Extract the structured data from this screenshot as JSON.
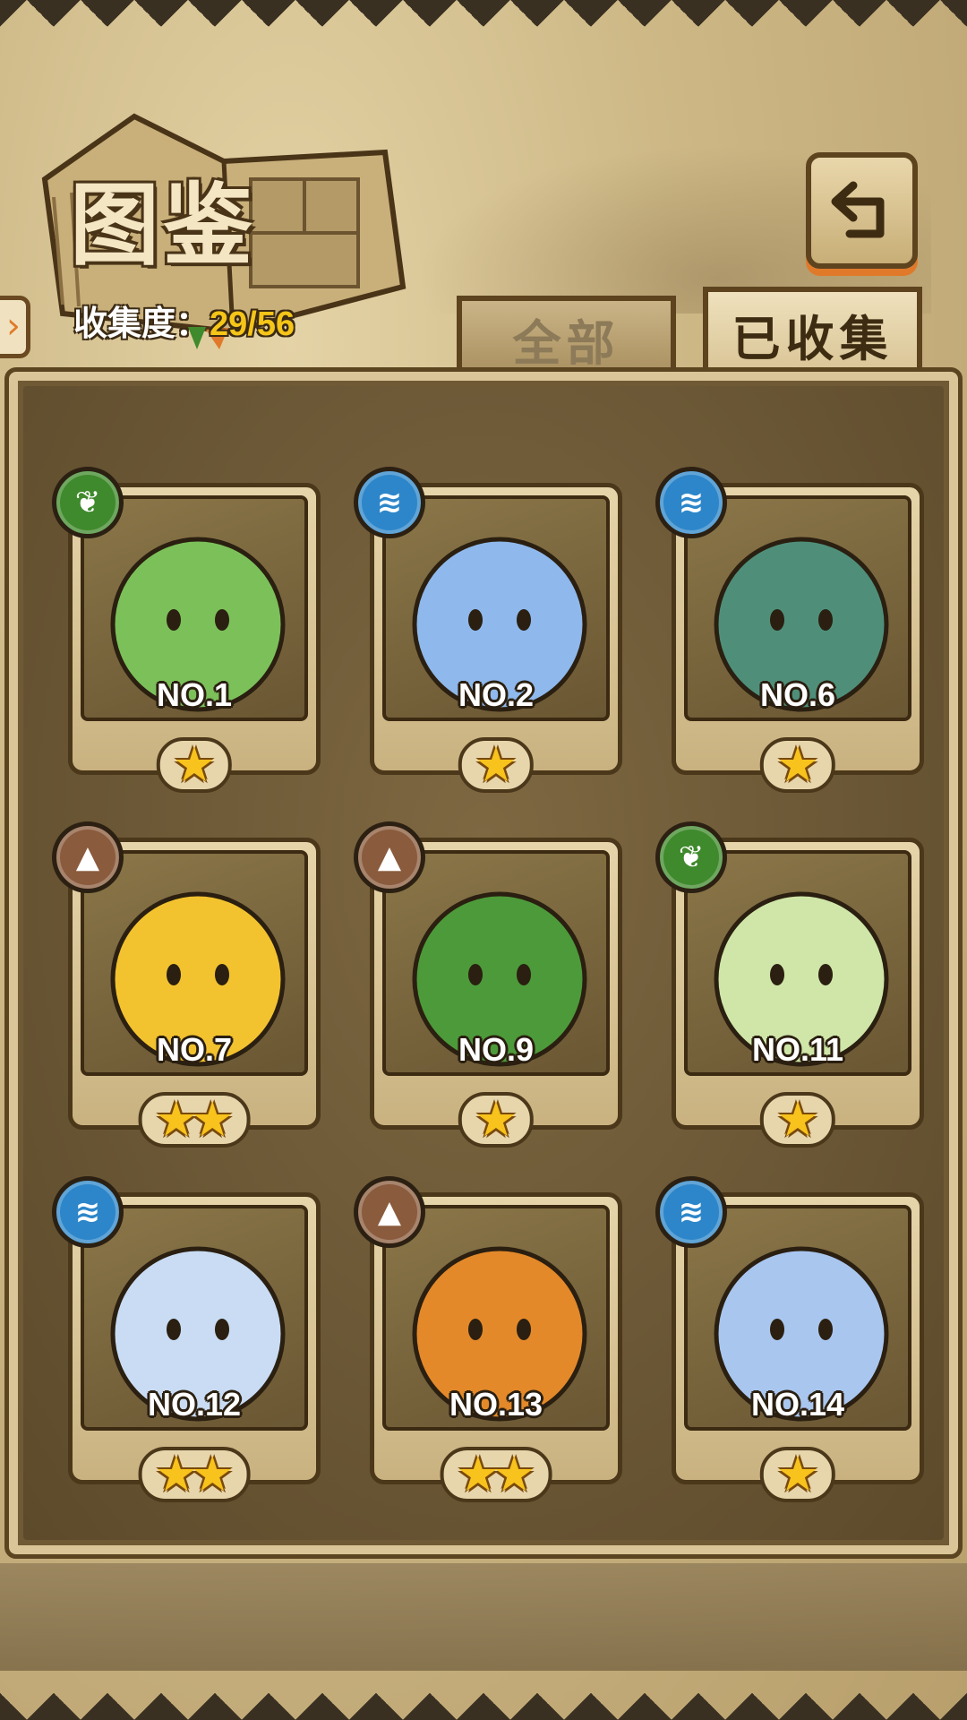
{
  "header": {
    "title": "图鉴",
    "collection_label": "收集度：",
    "collection_value": "29/56"
  },
  "tabs": [
    {
      "label": "全部",
      "active": false
    },
    {
      "label": "已收集",
      "active": true
    }
  ],
  "colors": {
    "grass": "#3f8a2c",
    "water": "#2d86c9",
    "earth": "#8a5b3c",
    "star": "#f7c31c",
    "collection_value": "#f5c518"
  },
  "cards": [
    {
      "no": "NO.1",
      "element": "grass",
      "element_icon": "leaf-icon",
      "stars": 1,
      "art_color": "#7cc05a"
    },
    {
      "no": "NO.2",
      "element": "water",
      "element_icon": "water-wave-icon",
      "stars": 1,
      "art_color": "#8fb8ec"
    },
    {
      "no": "NO.6",
      "element": "water",
      "element_icon": "water-wave-icon",
      "stars": 1,
      "art_color": "#4f8f7a"
    },
    {
      "no": "NO.7",
      "element": "earth",
      "element_icon": "mountain-icon",
      "stars": 2,
      "art_color": "#f3c22f"
    },
    {
      "no": "NO.9",
      "element": "earth",
      "element_icon": "mountain-icon",
      "stars": 1,
      "art_color": "#4d9a3a"
    },
    {
      "no": "NO.11",
      "element": "grass",
      "element_icon": "leaf-icon",
      "stars": 1,
      "art_color": "#cfe6a8"
    },
    {
      "no": "NO.12",
      "element": "water",
      "element_icon": "water-wave-icon",
      "stars": 2,
      "art_color": "#c9dcf4"
    },
    {
      "no": "NO.13",
      "element": "earth",
      "element_icon": "mountain-icon",
      "stars": 2,
      "art_color": "#e3892a"
    },
    {
      "no": "NO.14",
      "element": "water",
      "element_icon": "water-wave-icon",
      "stars": 1,
      "art_color": "#a9c6ef"
    }
  ]
}
